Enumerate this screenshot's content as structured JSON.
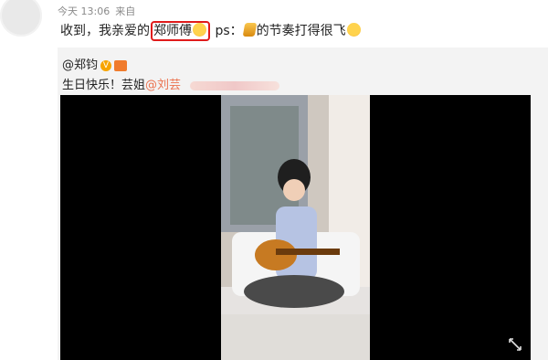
{
  "post": {
    "time": "今天 13:06",
    "source": "来自",
    "text_before": "收到，我亲爱的",
    "highlighted_name": "郑师傅",
    "text_ps": " ps：",
    "text_after": "的节奏打得很飞"
  },
  "repost": {
    "mention": "@郑钧",
    "v_badge": "V",
    "birthday_text": "生日快乐！芸姐",
    "birthday_link": "@刘芸"
  },
  "icons": [
    "laugh-emoji-icon",
    "ps-emoji-icon",
    "verified-badge-icon",
    "crown-badge-icon",
    "expand-icon"
  ],
  "colors": {
    "highlight_border": "#e01b1b",
    "link": "#eb7350",
    "badge": "#f7a400"
  }
}
